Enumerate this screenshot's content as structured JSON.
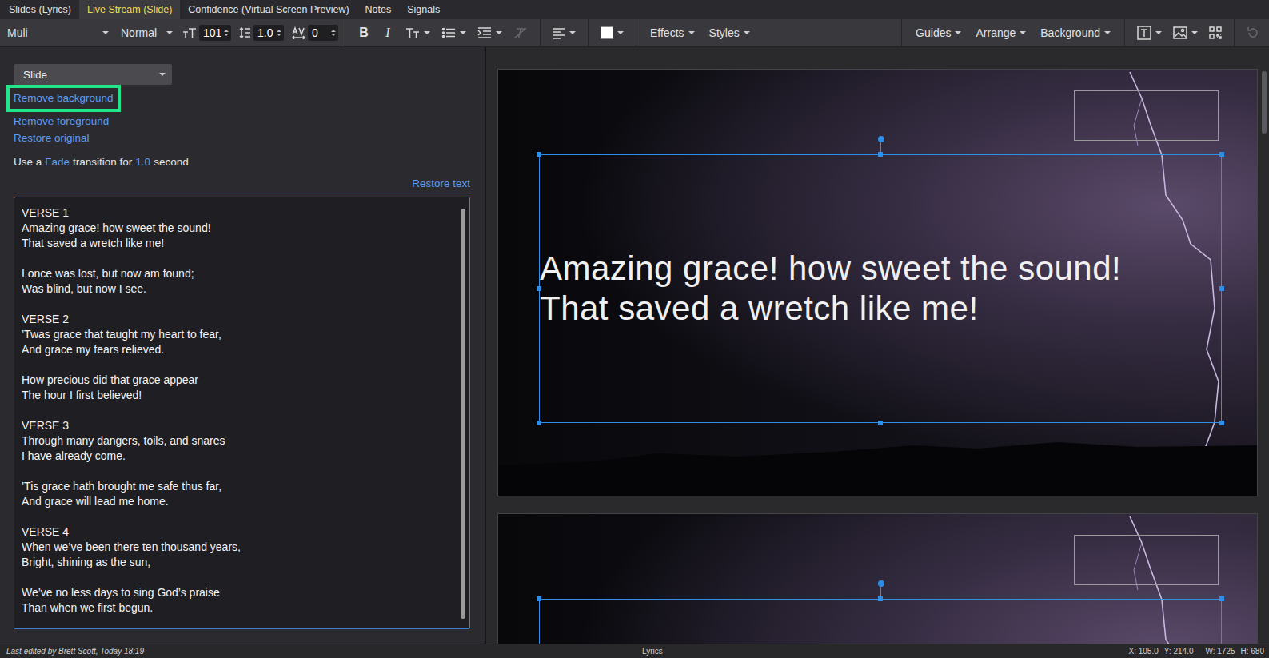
{
  "tabs": [
    {
      "label": "Slides (Lyrics)",
      "selected": false
    },
    {
      "label": "Live Stream (Slide)",
      "selected": true
    },
    {
      "label": "Confidence (Virtual Screen Preview)",
      "selected": false
    },
    {
      "label": "Notes",
      "selected": false
    },
    {
      "label": "Signals",
      "selected": false
    }
  ],
  "toolbar": {
    "font": "Muli",
    "weight": "Normal",
    "font_size": "101",
    "line_height": "1.0",
    "letter_spacing": "0",
    "bold": "B",
    "italic": "I",
    "clear_format_disabled": true,
    "text_color": "#ffffff",
    "menus": [
      "Effects",
      "Styles"
    ],
    "right_menus": [
      "Guides",
      "Arrange",
      "Background"
    ],
    "undo_disabled": true
  },
  "panel": {
    "layer": "Slide",
    "actions": [
      {
        "label": "Remove background",
        "highlighted": true
      },
      {
        "label": "Remove foreground",
        "highlighted": false
      },
      {
        "label": "Restore original",
        "highlighted": false
      }
    ],
    "transition": {
      "prefix": "Use a",
      "effect": "Fade",
      "middle": "transition for",
      "duration": "1.0",
      "suffix": "second"
    },
    "restore_text": "Restore text",
    "lyrics": [
      [
        "VERSE 1",
        "Amazing grace! how sweet the sound!",
        "That saved a wretch like me!"
      ],
      [
        "I once was lost, but now am found;",
        "Was blind, but now I see."
      ],
      [
        "VERSE 2",
        "’Twas grace that taught my heart to fear,",
        "And grace my fears relieved."
      ],
      [
        "How precious did that grace appear",
        "The hour I first believed!"
      ],
      [
        "VERSE 3",
        "Through many dangers, toils, and snares",
        "I have already come."
      ],
      [
        "’Tis grace hath brought me safe thus far,",
        "And grace will lead me home."
      ],
      [
        "VERSE 4",
        "When we’ve been there ten thousand years,",
        "Bright, shining as the sun,"
      ],
      [
        "We’ve no less days to sing God’s praise",
        "Than when we first begun."
      ]
    ]
  },
  "slides": [
    {
      "lines": [
        "Amazing grace! how sweet the sound!",
        "That saved a wretch like me!"
      ],
      "selected": true
    },
    {
      "lines": [],
      "selected": true
    }
  ],
  "status_bar": {
    "edited": "Last edited by Brett Scott, Today 18:19",
    "layer": "Lyrics",
    "x": "X: 105.0",
    "y": "Y: 214.0",
    "w": "W: 1725",
    "h": "H: 680"
  }
}
